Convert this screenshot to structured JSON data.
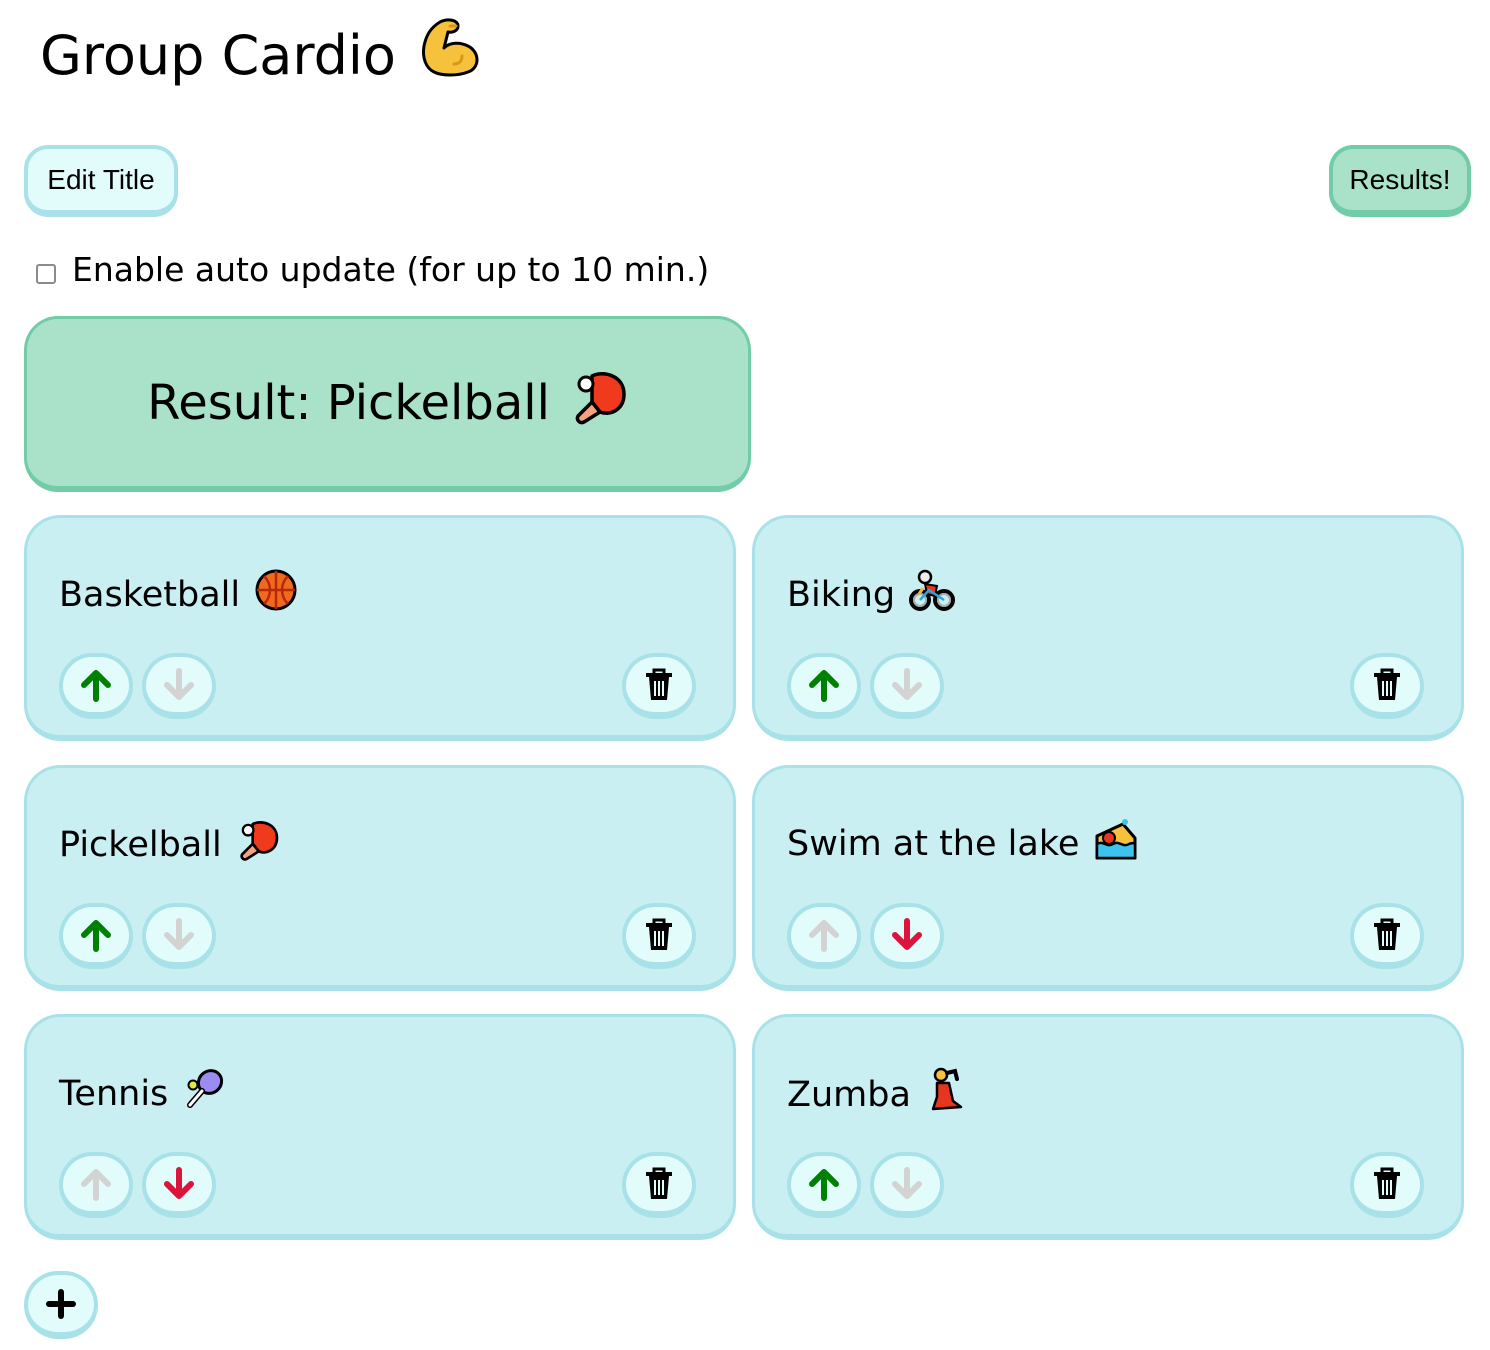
{
  "header": {
    "title": "Group Cardio",
    "title_icon": "flexed-biceps"
  },
  "toolbar": {
    "edit_title_label": "Edit Title",
    "results_label": "Results!"
  },
  "auto_update": {
    "label": "Enable auto update (for up to 10 min.)",
    "checked": false
  },
  "result": {
    "text": "Result: Pickelball",
    "icon": "ping-pong-paddle"
  },
  "colors": {
    "card_bg": "#c9eff3",
    "card_border": "#a8e2e8",
    "button_bg": "#e2fcfc",
    "result_bg": "#a9e2c8",
    "result_border": "#72cca8",
    "vote_up_active": "#008000",
    "vote_down_active": "#dc143c",
    "vote_disabled": "#d3d3d3"
  },
  "options": [
    {
      "label": "Basketball",
      "icon": "basketball",
      "up_enabled": true,
      "down_enabled": false
    },
    {
      "label": "Biking",
      "icon": "person-biking",
      "up_enabled": true,
      "down_enabled": false
    },
    {
      "label": "Pickelball",
      "icon": "ping-pong-paddle",
      "up_enabled": true,
      "down_enabled": false
    },
    {
      "label": "Swim at the lake",
      "icon": "person-swimming",
      "up_enabled": false,
      "down_enabled": true
    },
    {
      "label": "Tennis",
      "icon": "tennis-racket",
      "up_enabled": false,
      "down_enabled": true
    },
    {
      "label": "Zumba",
      "icon": "woman-dancing",
      "up_enabled": true,
      "down_enabled": false
    }
  ],
  "add_button": {
    "icon": "plus"
  }
}
